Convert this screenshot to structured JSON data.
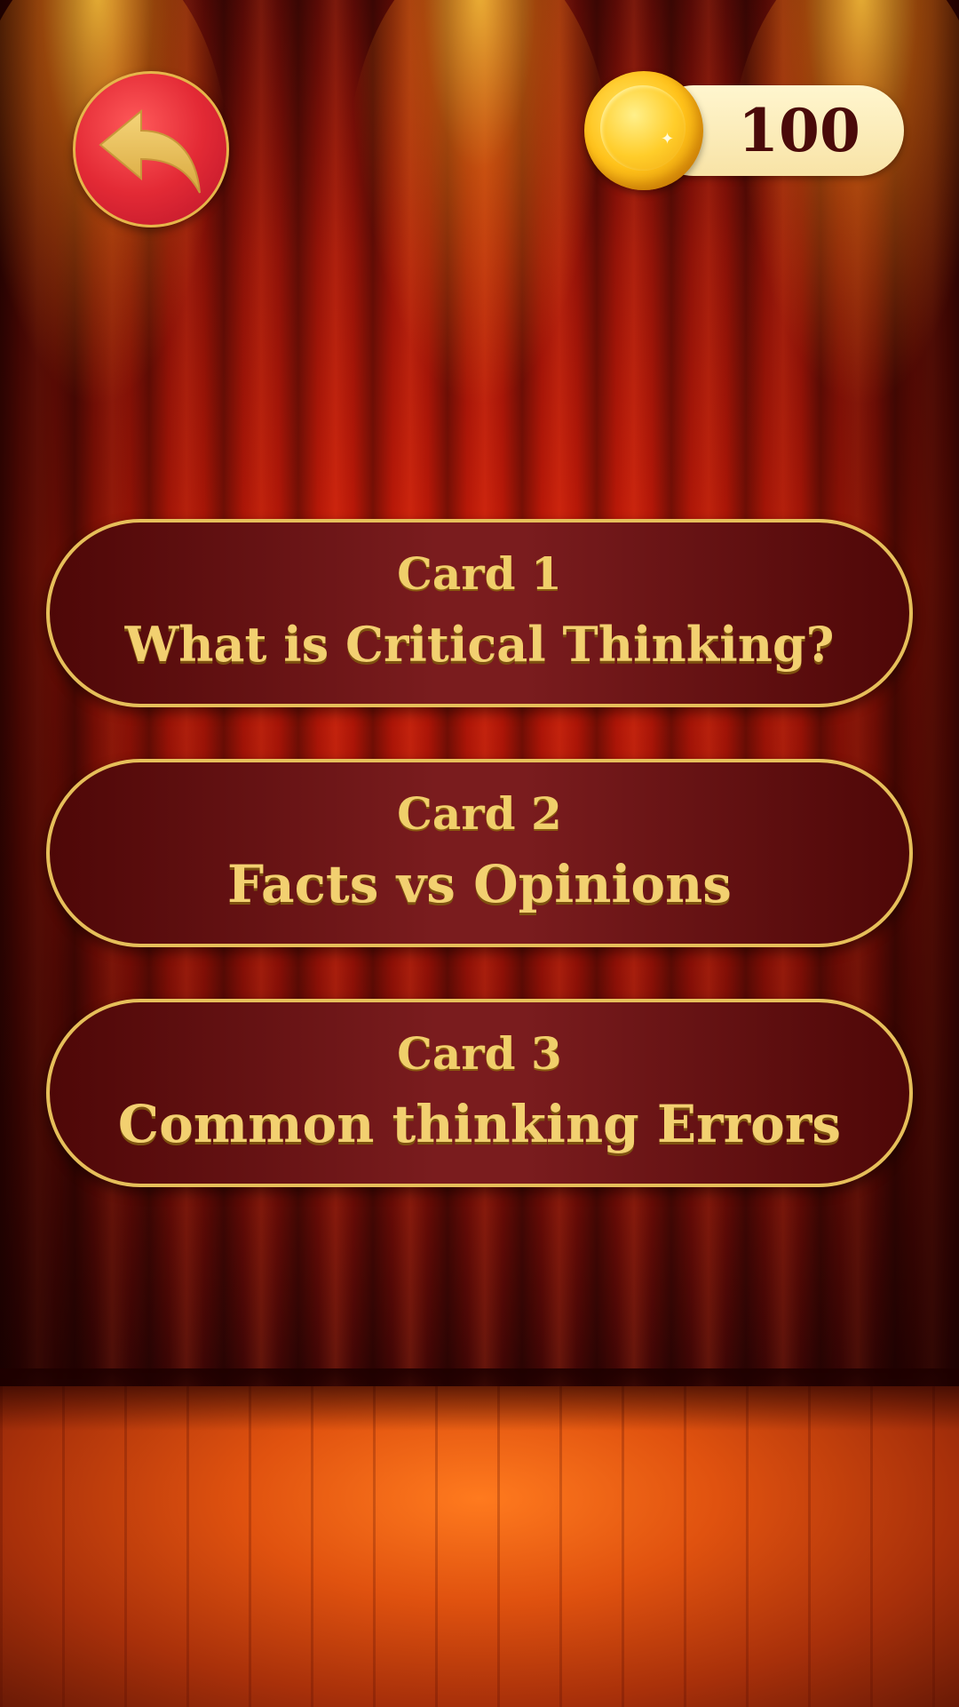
{
  "header": {
    "back_icon": "undo-arrow-icon",
    "coin_icon": "gold-coin-icon",
    "coins": "100"
  },
  "cards": [
    {
      "number_label": "Card 1",
      "title": "What is Critical Thinking?"
    },
    {
      "number_label": "Card 2",
      "title": "Facts vs Opinions"
    },
    {
      "number_label": "Card 3",
      "title": "Common thinking Errors"
    }
  ],
  "colors": {
    "accent_gold": "#e6bf5a",
    "card_bg": "#7a1c1e",
    "back_button": "#e32a35"
  }
}
